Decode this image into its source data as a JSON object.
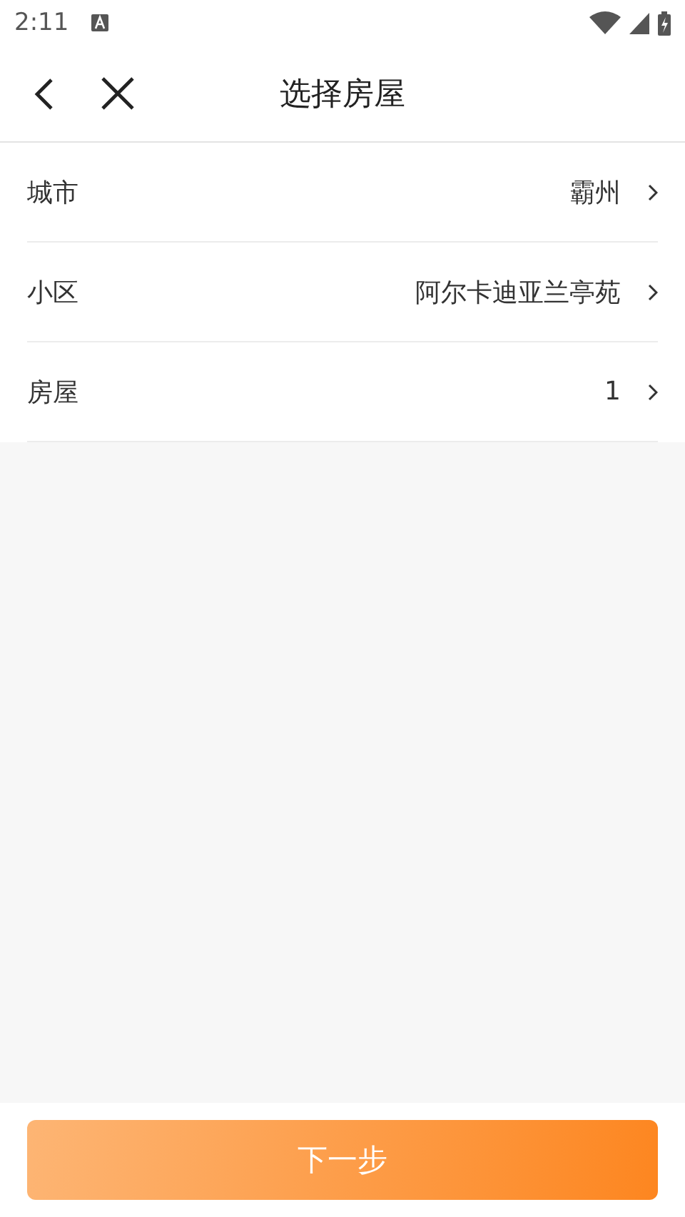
{
  "status_bar": {
    "time": "2:11"
  },
  "header": {
    "title": "选择房屋"
  },
  "rows": [
    {
      "label": "城市",
      "value": "霸州"
    },
    {
      "label": "小区",
      "value": "阿尔卡迪亚兰亭苑"
    },
    {
      "label": "房屋",
      "value": "1"
    }
  ],
  "next_button": {
    "label": "下一步"
  }
}
